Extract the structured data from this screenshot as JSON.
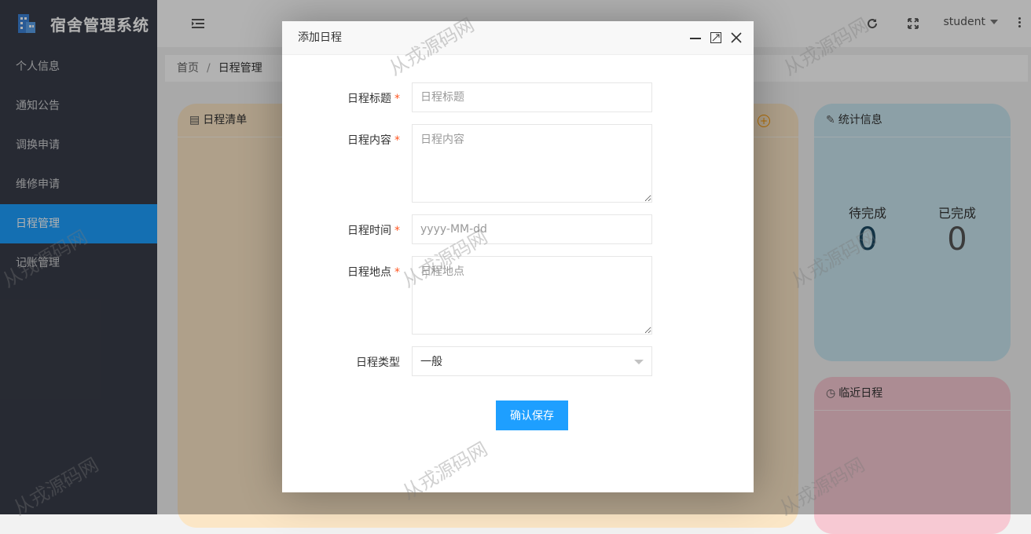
{
  "app": {
    "title": "宿舍管理系统"
  },
  "sidebar": {
    "items": [
      {
        "label": "个人信息"
      },
      {
        "label": "通知公告"
      },
      {
        "label": "调换申请"
      },
      {
        "label": "维修申请"
      },
      {
        "label": "日程管理",
        "active": true
      },
      {
        "label": "记账管理"
      }
    ]
  },
  "header": {
    "user": "student"
  },
  "breadcrumb": {
    "home": "首页",
    "separator": "/",
    "current": "日程管理"
  },
  "cards": {
    "schedule_list": {
      "title": "日程清单"
    },
    "stats": {
      "title": "统计信息",
      "pending_label": "待完成",
      "pending_value": "0",
      "done_label": "已完成",
      "done_value": "0"
    },
    "upcoming": {
      "title": "临近日程"
    }
  },
  "modal": {
    "title": "添加日程",
    "fields": {
      "title": {
        "label": "日程标题",
        "placeholder": "日程标题"
      },
      "content": {
        "label": "日程内容",
        "placeholder": "日程内容"
      },
      "time": {
        "label": "日程时间",
        "placeholder": "yyyy-MM-dd"
      },
      "place": {
        "label": "日程地点",
        "placeholder": "日程地点"
      },
      "type": {
        "label": "日程类型",
        "value": "一般"
      }
    },
    "required_mark": "*",
    "save_label": "确认保存"
  },
  "watermark": "从戎源码网",
  "colors": {
    "accent": "#1e9fff",
    "sidebar": "#393d49",
    "required": "#ff5722"
  }
}
